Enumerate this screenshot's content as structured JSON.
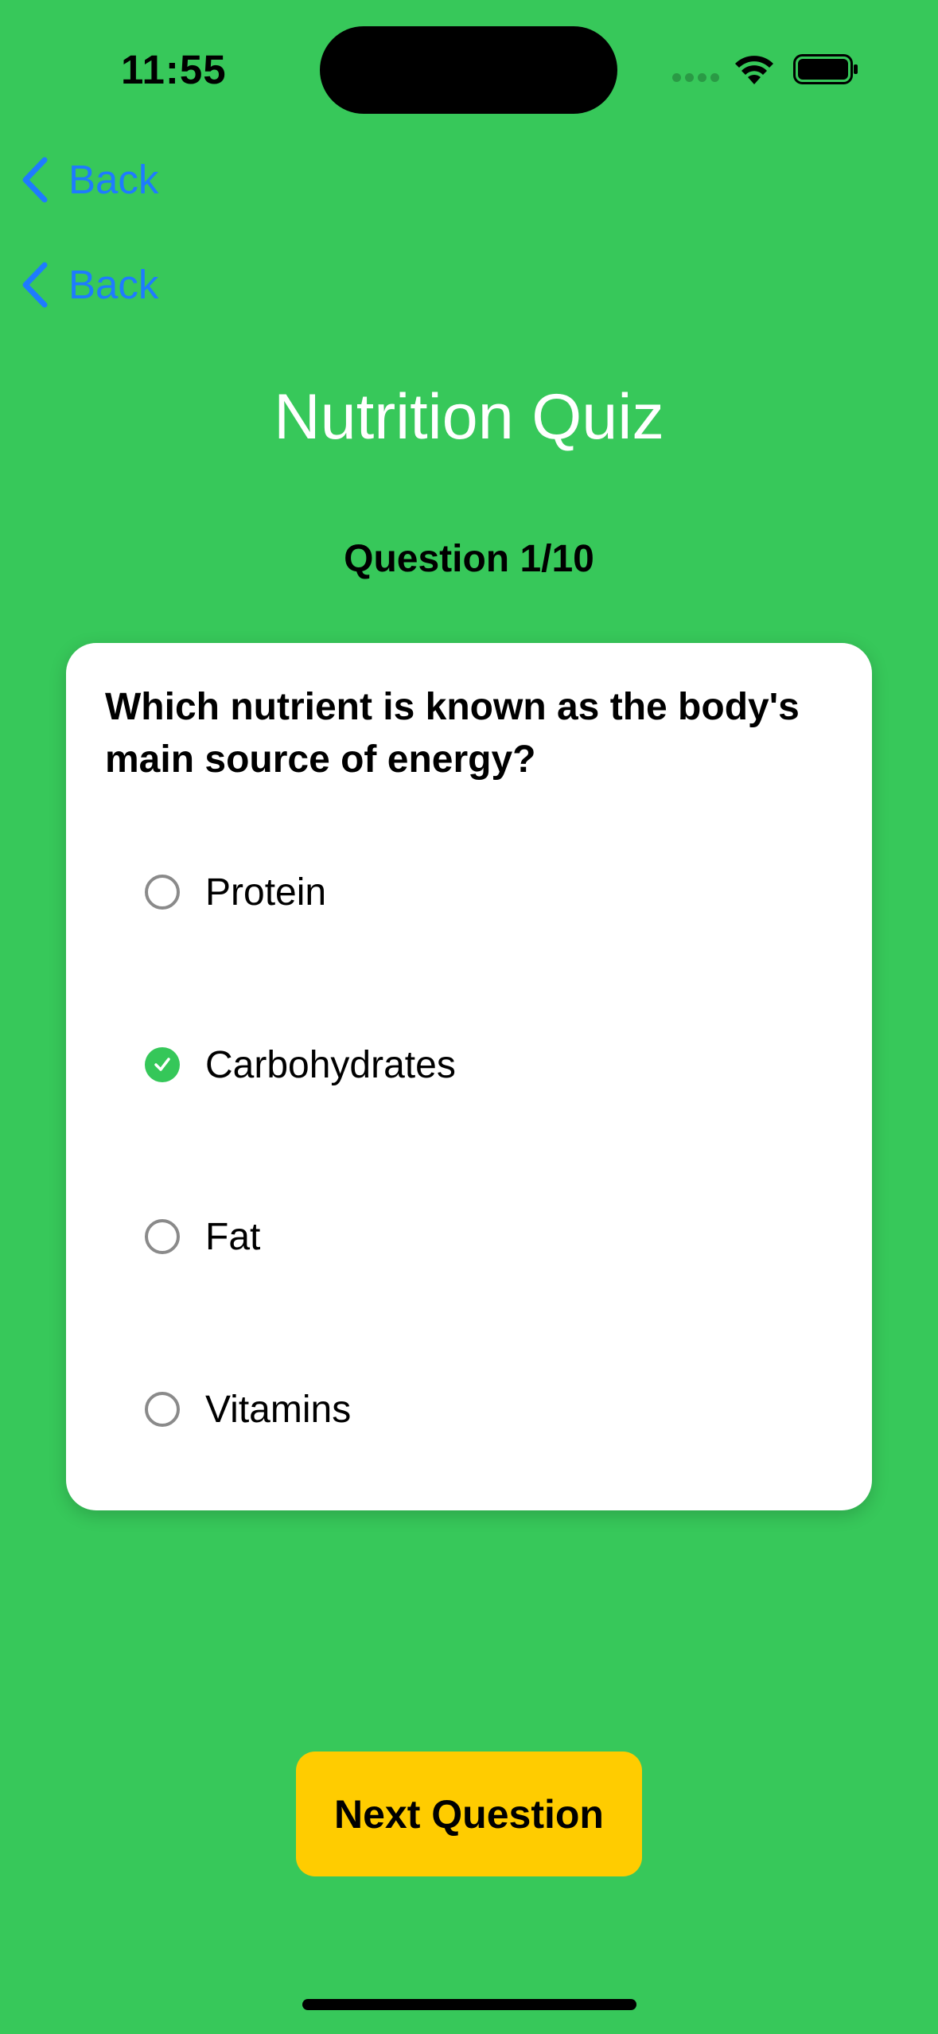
{
  "status_bar": {
    "time": "11:55",
    "icons": [
      "cellular-dots-icon",
      "wifi-icon",
      "battery-icon"
    ]
  },
  "nav": {
    "back_buttons": [
      {
        "label": "Back",
        "icon": "chevron-left-icon"
      },
      {
        "label": "Back",
        "icon": "chevron-left-icon"
      }
    ]
  },
  "quiz": {
    "title": "Nutrition Quiz",
    "counter": "Question 1/10",
    "question": "Which nutrient is known as the body's main source of energy?",
    "options": [
      {
        "label": "Protein",
        "selected": false
      },
      {
        "label": "Carbohydrates",
        "selected": true
      },
      {
        "label": "Fat",
        "selected": false
      },
      {
        "label": "Vitamins",
        "selected": false
      }
    ],
    "next_label": "Next Question"
  },
  "colors": {
    "background": "#37c85a",
    "accent_link": "#1e7bff",
    "button": "#ffcc00",
    "check": "#35c759"
  }
}
